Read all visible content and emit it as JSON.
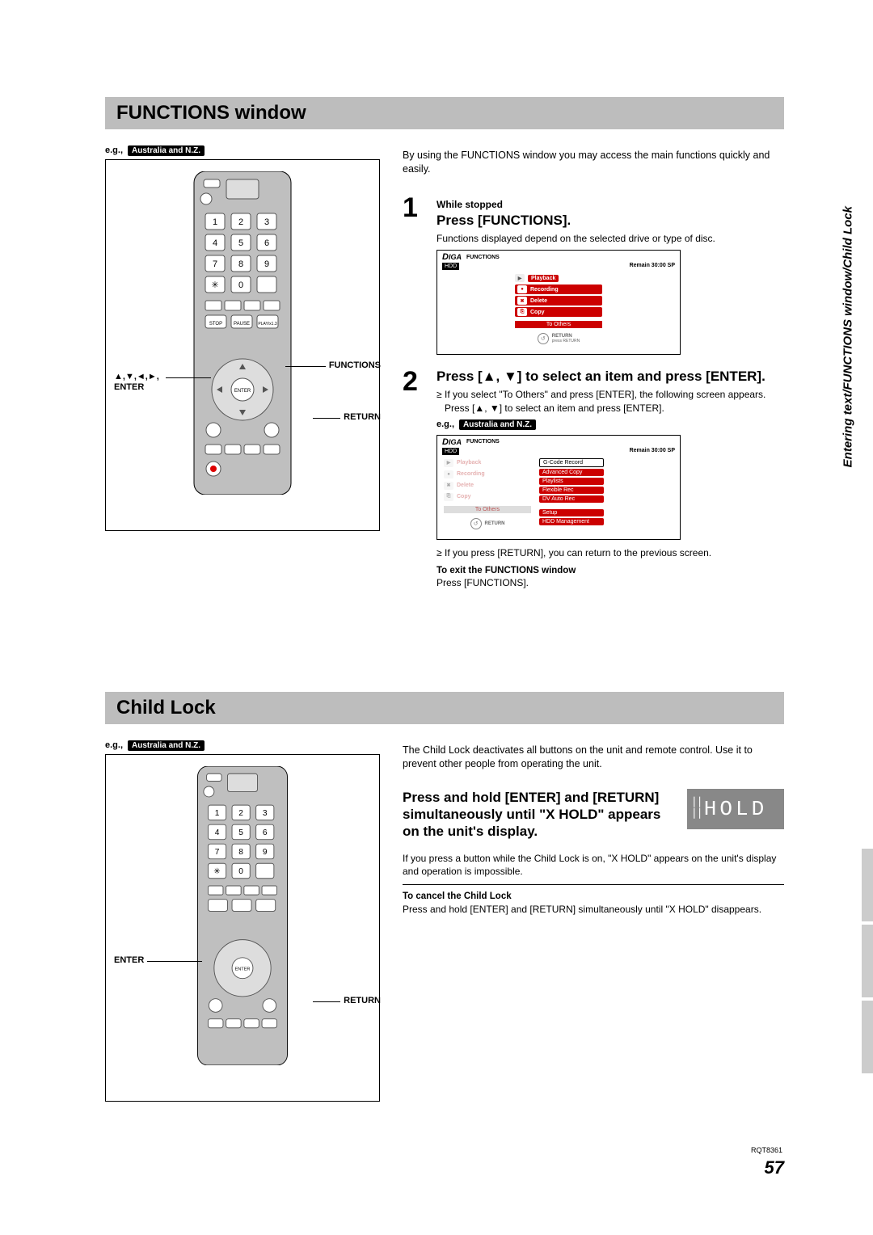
{
  "sideText": "Entering text/FUNCTIONS window/Child Lock",
  "pageNumber": "57",
  "docCode": "RQT8361",
  "funcSection": {
    "heading": "FUNCTIONS window",
    "egPrefix": "e.g.,",
    "regionTag": "Australia and N.Z.",
    "callouts": {
      "functions": "FUNCTIONS",
      "arrowsEnter": "▲,▼,◄,►, ENTER",
      "return": "RETURN"
    },
    "intro": "By using the FUNCTIONS window you may access the main functions quickly and easily.",
    "step1": {
      "num": "1",
      "pre": "While stopped",
      "main": "Press [FUNCTIONS].",
      "note": "Functions displayed depend on the selected drive or type of disc.",
      "screen": {
        "diga": "DIGA",
        "label": "FUNCTIONS",
        "hdd": "HDD",
        "remain": "Remain 30:00 SP",
        "items": [
          "Playback",
          "Recording",
          "Delete",
          "Copy"
        ],
        "toOthers": "To Others",
        "retText": "RETURN",
        "retSub": "press RETURN"
      }
    },
    "step2": {
      "num": "2",
      "main": "Press [▲, ▼] to select an item and press [ENTER].",
      "bullet1": "If you select \"To Others\" and press [ENTER], the following screen appears. Press [▲, ▼] to select an item and press [ENTER].",
      "egPrefix": "e.g.,",
      "regionTag": "Australia and N.Z.",
      "screen": {
        "diga": "DIGA",
        "label": "FUNCTIONS",
        "hdd": "HDD",
        "remain": "Remain 30:00 SP",
        "leftItems": [
          "Playback",
          "Recording",
          "Delete",
          "Copy"
        ],
        "toOthers": "To Others",
        "rightItems": [
          "G-Code Record",
          "Advanced Copy",
          "Playlists",
          "Flexible Rec",
          "DV Auto Rec",
          "Setup",
          "HDD Management"
        ],
        "retText": "RETURN"
      },
      "bullet2": "If you press [RETURN], you can return to the previous screen.",
      "exitHead": "To exit the FUNCTIONS window",
      "exitBody": "Press [FUNCTIONS]."
    }
  },
  "lockSection": {
    "heading": "Child Lock",
    "egPrefix": "e.g.,",
    "regionTag": "Australia and N.Z.",
    "callouts": {
      "enter": "ENTER",
      "return": "RETURN"
    },
    "intro": "The Child Lock deactivates all buttons on the unit and remote control. Use it to prevent other people from operating the unit.",
    "main": "Press and hold [ENTER] and [RETURN] simultaneously until \"X HOLD\" appears on the unit's display.",
    "holdDisplay": {
      "x": "X",
      "hold": "HOLD"
    },
    "afterNote": "If you press a button while the Child Lock is on, \"X HOLD\" appears on the unit's display and operation is impossible.",
    "cancelHead": "To cancel the Child Lock",
    "cancelBody": "Press and hold [ENTER] and [RETURN] simultaneously until \"X HOLD\" disappears."
  }
}
